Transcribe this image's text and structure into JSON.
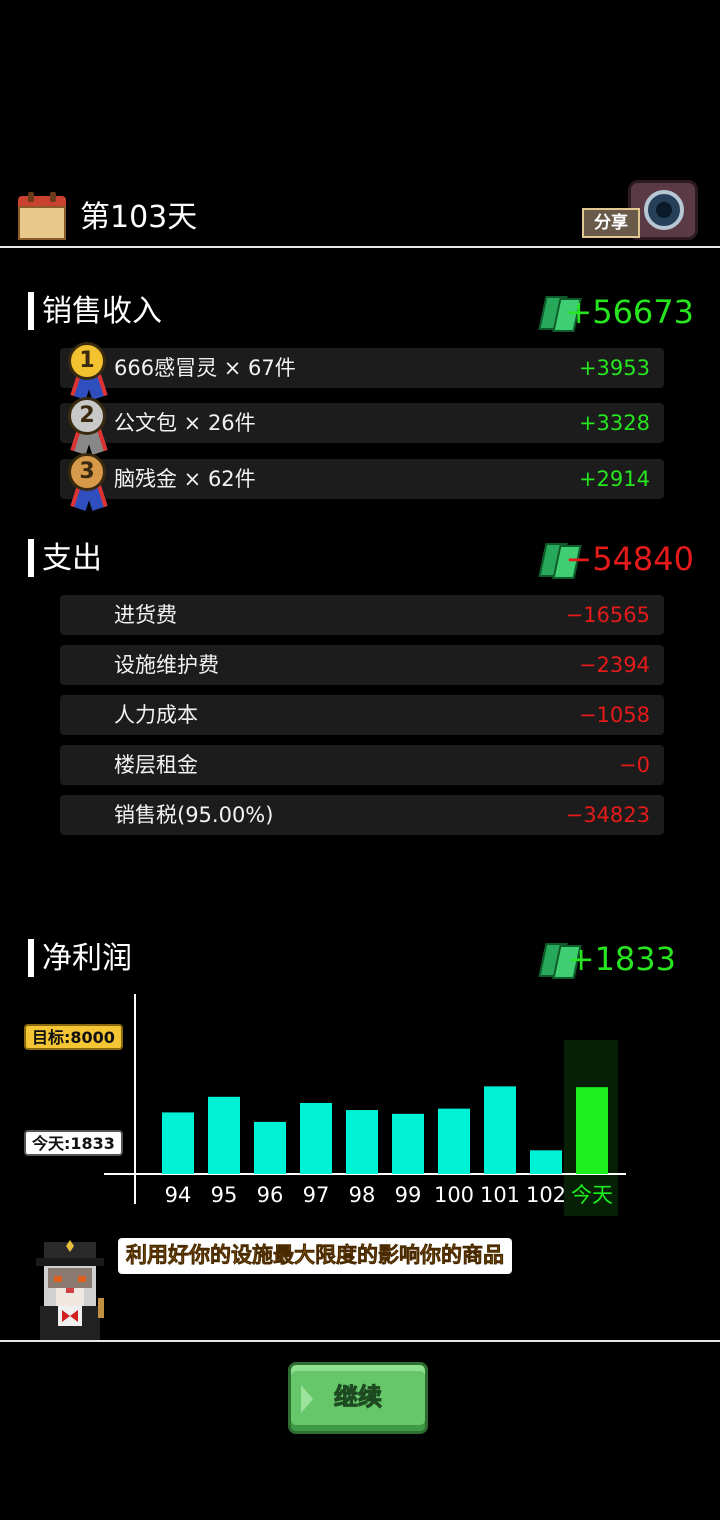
{
  "header": {
    "day_title": "第103天",
    "share_label": "分享"
  },
  "income": {
    "title": "销售收入",
    "total": "+56673",
    "items": [
      {
        "rank": "1",
        "name": "666感冒灵 × 67件",
        "value": "+3953",
        "medal_color": "#f2c230"
      },
      {
        "rank": "2",
        "name": "公文包 × 26件",
        "value": "+3328",
        "medal_color": "#c8c8c8"
      },
      {
        "rank": "3",
        "name": "脑残金 × 62件",
        "value": "+2914",
        "medal_color": "#d79a4a"
      }
    ]
  },
  "expense": {
    "title": "支出",
    "total": "−54840",
    "items": [
      {
        "name": "进货费",
        "value": "−16565"
      },
      {
        "name": "设施维护费",
        "value": "−2394"
      },
      {
        "name": "人力成本",
        "value": "−1058"
      },
      {
        "name": "楼层租金",
        "value": "−0"
      },
      {
        "name": "销售税(95.00%)",
        "value": "−34823"
      }
    ]
  },
  "profit": {
    "title": "净利润",
    "total": "+1833"
  },
  "chart_data": {
    "type": "bar",
    "categories": [
      "94",
      "95",
      "96",
      "97",
      "98",
      "99",
      "100",
      "101",
      "102",
      "今天"
    ],
    "values": [
      1300,
      1630,
      1100,
      1500,
      1350,
      1270,
      1380,
      1850,
      500,
      1833
    ],
    "goal_label": "目标:8000",
    "goal_value": 8000,
    "today_label": "今天:1833",
    "ylim": [
      0,
      3800
    ],
    "colors": {
      "past": "#00f2d6",
      "today": "#1cf01c",
      "today_bg": "#062006"
    }
  },
  "tip": {
    "text": "利用好你的设施最大限度的影响你的商品"
  },
  "continue_label": "继续"
}
